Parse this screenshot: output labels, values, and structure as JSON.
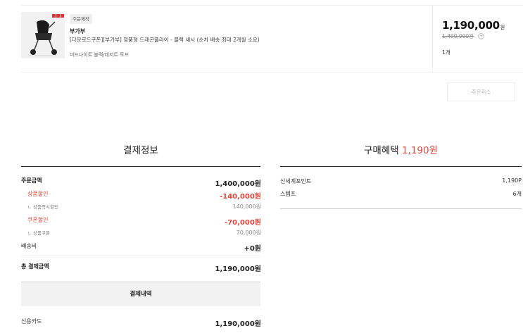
{
  "product": {
    "custom_badge": "주문제작",
    "brand": "부가부",
    "name": "[다운로드쿠폰][부가부] 정품형 드래곤플라이 - 블랙 섀시 (순차 배송 최대 2개월 소요)",
    "option": "미드나이트 블랙/데저트 토프",
    "price": "1,190,000",
    "price_unit": "원",
    "original_price": "1,400,000원",
    "info_icon": "info-icon",
    "quantity": "1개"
  },
  "actions": {
    "cancel_label": "주문취소"
  },
  "payment": {
    "title": "결제정보",
    "order_amount_label": "주문금액",
    "order_amount": "1,400,000원",
    "product_discount_label": "상품할인",
    "product_discount": "-140,000원",
    "instant_discount_label": "ㄴ 상품즉시할인",
    "instant_discount": "140,000원",
    "coupon_discount_label": "쿠폰할인",
    "coupon_discount": "-70,000원",
    "product_coupon_label": "ㄴ 상품쿠폰",
    "product_coupon": "70,000원",
    "shipping_label": "배송비",
    "shipping": "+0원",
    "total_label": "총 결제금액",
    "total": "1,190,000원",
    "details_title": "결제내역",
    "card_label": "신용카드",
    "card_amount": "1,190,000원"
  },
  "benefit": {
    "title": "구매혜택",
    "amount": "1,190원",
    "points_label": "신세계포인트",
    "points": "1,190P",
    "stamp_label": "스탬프",
    "stamp": "6개"
  },
  "colors": {
    "accent_red": "#e5473a",
    "text": "#222222",
    "muted": "#888888"
  }
}
